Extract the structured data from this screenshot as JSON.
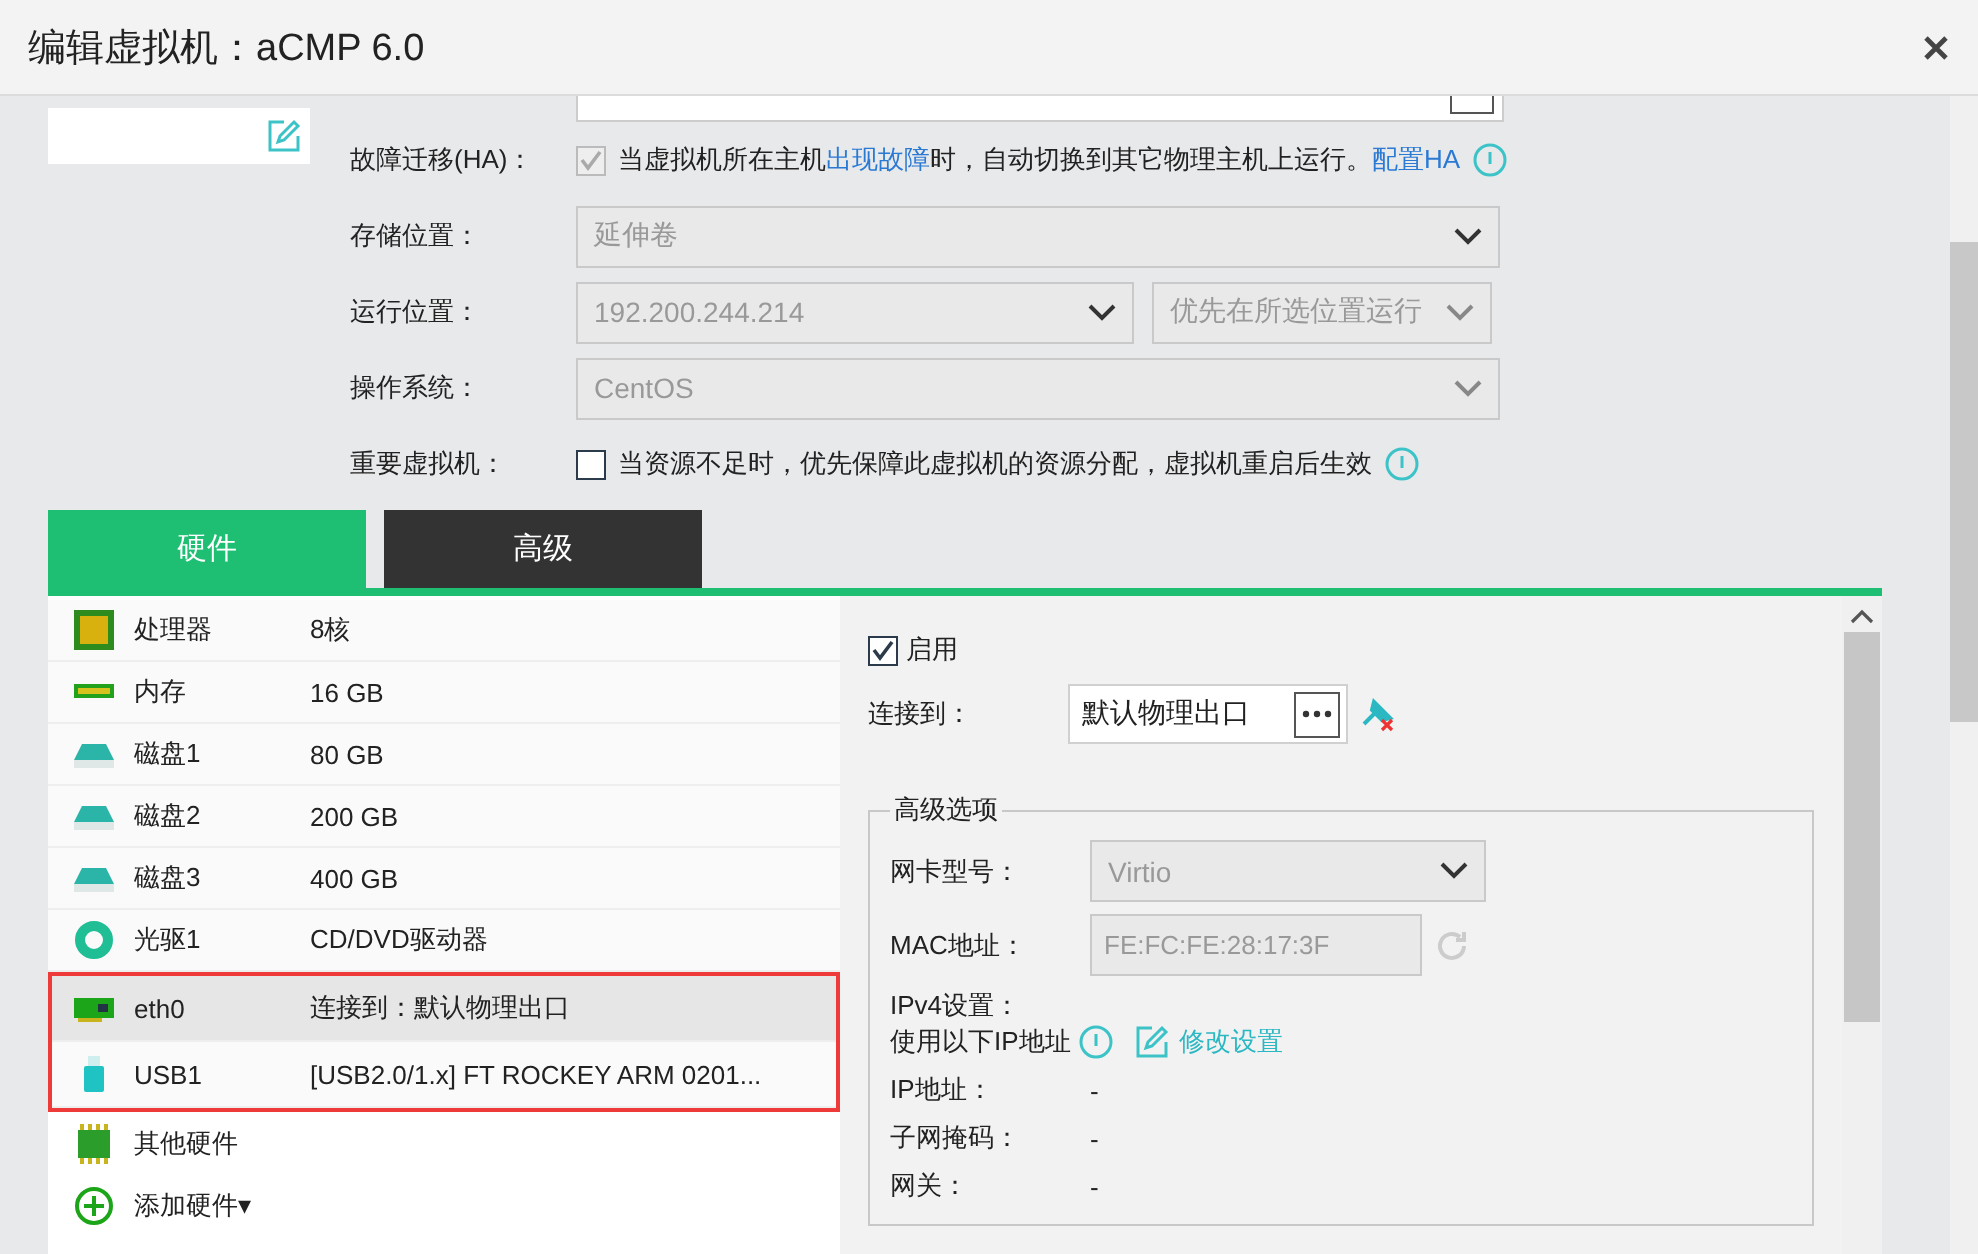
{
  "window": {
    "title": "编辑虚拟机：aCMP 6.0"
  },
  "form": {
    "ha": {
      "label": "故障迁移(HA)：",
      "checked": true,
      "disabled": true,
      "segments": [
        {
          "kind": "plain",
          "text": "当虚拟机所在主机"
        },
        {
          "kind": "link",
          "text": "出现故障"
        },
        {
          "kind": "plain",
          "text": "时，自动切换到其它物理主机上运行。"
        },
        {
          "kind": "link",
          "text": "配置HA"
        }
      ]
    },
    "storage": {
      "label": "存储位置：",
      "value": "延伸卷",
      "disabled": true
    },
    "run_location": {
      "label": "运行位置：",
      "host": "192.200.244.214",
      "policy": "优先在所选位置运行"
    },
    "os": {
      "label": "操作系统：",
      "value": "CentOS",
      "disabled": true
    },
    "important": {
      "label": "重要虚拟机：",
      "checked": false,
      "text": "当资源不足时，优先保障此虚拟机的资源分配，虚拟机重启后生效"
    }
  },
  "tabs": [
    {
      "label": "硬件",
      "selected": true
    },
    {
      "label": "高级",
      "selected": false
    }
  ],
  "hardware": [
    {
      "kind": "cpu",
      "name": "处理器",
      "value": "8核",
      "selected": false,
      "highlighted": false
    },
    {
      "kind": "memory",
      "name": "内存",
      "value": "16 GB",
      "selected": false,
      "highlighted": false
    },
    {
      "kind": "disk",
      "name": "磁盘1",
      "value": "80 GB",
      "selected": false,
      "highlighted": false
    },
    {
      "kind": "disk",
      "name": "磁盘2",
      "value": "200 GB",
      "selected": false,
      "highlighted": false
    },
    {
      "kind": "disk",
      "name": "磁盘3",
      "value": "400 GB",
      "selected": false,
      "highlighted": false
    },
    {
      "kind": "cdrom",
      "name": "光驱1",
      "value": "CD/DVD驱动器",
      "selected": false,
      "highlighted": false
    },
    {
      "kind": "nic",
      "name": "eth0",
      "value": "连接到：默认物理出口",
      "selected": true,
      "highlighted": true
    },
    {
      "kind": "usb",
      "name": "USB1",
      "value": "[USB2.0/1.x] FT ROCKEY ARM 0201...",
      "selected": false,
      "highlighted": true
    },
    {
      "kind": "other",
      "name": "其他硬件",
      "selected": false,
      "highlighted": false
    },
    {
      "kind": "add",
      "name": "添加硬件▾",
      "selected": false,
      "highlighted": false
    }
  ],
  "detail": {
    "enable": {
      "label": "启用",
      "checked": true
    },
    "connect": {
      "label": "连接到：",
      "value": "默认物理出口"
    },
    "advanced": {
      "legend": "高级选项",
      "nic_model": {
        "label": "网卡型号：",
        "value": "Virtio",
        "disabled": true
      },
      "mac": {
        "label": "MAC地址：",
        "value": "FE:FC:FE:28:17:3F",
        "disabled": true
      },
      "ipv4": {
        "label": "IPv4设置：",
        "mode": "使用以下IP地址",
        "edit_link": "修改设置"
      },
      "fields": [
        {
          "label": "IP地址：",
          "value": "-"
        },
        {
          "label": "子网掩码：",
          "value": "-"
        },
        {
          "label": "网关：",
          "value": "-"
        }
      ]
    }
  }
}
